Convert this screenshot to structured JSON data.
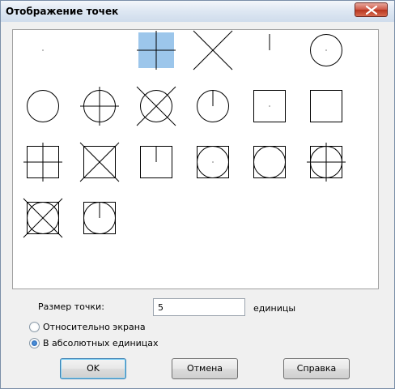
{
  "window": {
    "title": "Отображение точек",
    "close_icon": "close-icon"
  },
  "point_styles": [
    {
      "style": "dot",
      "selected": false
    },
    {
      "style": "none",
      "selected": false
    },
    {
      "style": "plus",
      "selected": true
    },
    {
      "style": "x",
      "selected": false
    },
    {
      "style": "tick",
      "selected": false
    },
    {
      "style": "circle-dot",
      "selected": false
    },
    {
      "style": "circle",
      "selected": false
    },
    {
      "style": "circle-plus",
      "selected": false
    },
    {
      "style": "circle-x",
      "selected": false
    },
    {
      "style": "circle-tick",
      "selected": false
    },
    {
      "style": "square-dot",
      "selected": false
    },
    {
      "style": "square",
      "selected": false
    },
    {
      "style": "square-plus",
      "selected": false
    },
    {
      "style": "square-x",
      "selected": false
    },
    {
      "style": "square-tick",
      "selected": false
    },
    {
      "style": "square-circle-dot",
      "selected": false
    },
    {
      "style": "square-circle",
      "selected": false
    },
    {
      "style": "square-circle-plus",
      "selected": false
    },
    {
      "style": "square-circle-x",
      "selected": false
    },
    {
      "style": "square-circle-tick",
      "selected": false
    }
  ],
  "size": {
    "label": "Размер точки:",
    "value": "5",
    "units": "единицы"
  },
  "mode": {
    "options": [
      {
        "label": "Относительно экрана",
        "checked": false
      },
      {
        "label": "В абсолютных единицах",
        "checked": true
      }
    ]
  },
  "buttons": {
    "ok": "OK",
    "cancel": "Отмена",
    "help": "Справка"
  }
}
